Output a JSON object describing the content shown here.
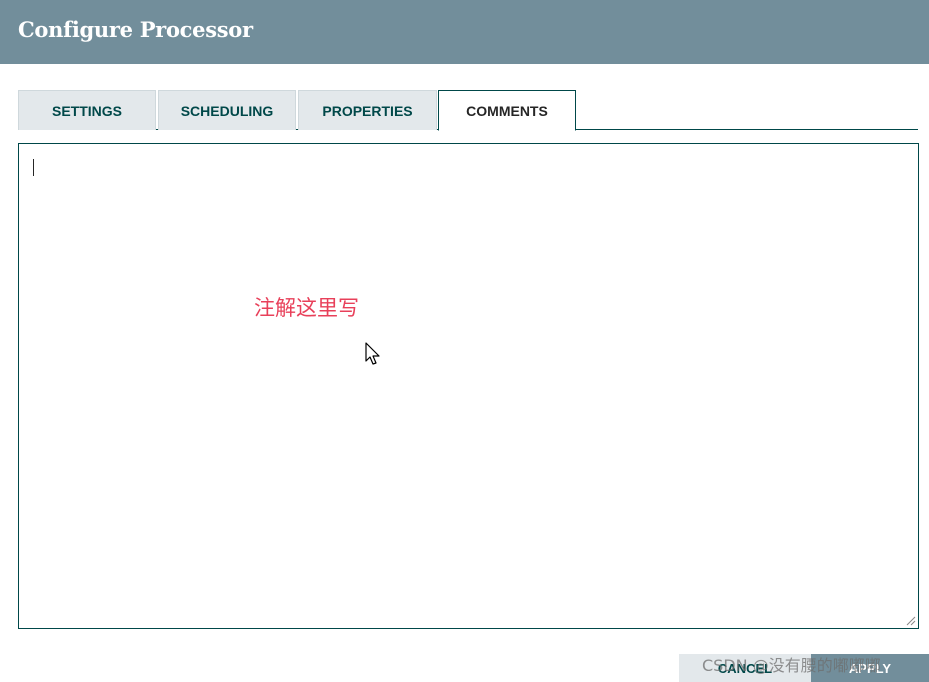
{
  "dialog": {
    "title": "Configure Processor"
  },
  "tabs": [
    {
      "label": "SETTINGS",
      "active": false
    },
    {
      "label": "SCHEDULING",
      "active": false
    },
    {
      "label": "PROPERTIES",
      "active": false
    },
    {
      "label": "COMMENTS",
      "active": true
    }
  ],
  "comments": {
    "value": "",
    "annotation": "注解这里写"
  },
  "footer": {
    "cancel_label": "CANCEL",
    "apply_label": "APPLY"
  },
  "watermark": "CSDN @没有腰的嘟嘟嘟",
  "colors": {
    "header": "#728e9b",
    "accent": "#004849",
    "tab_inactive": "#e3e8eb",
    "annotation": "#e8405a"
  },
  "icons": {
    "cursor": "mouse-pointer-icon",
    "grip": "resize-grip-icon"
  }
}
